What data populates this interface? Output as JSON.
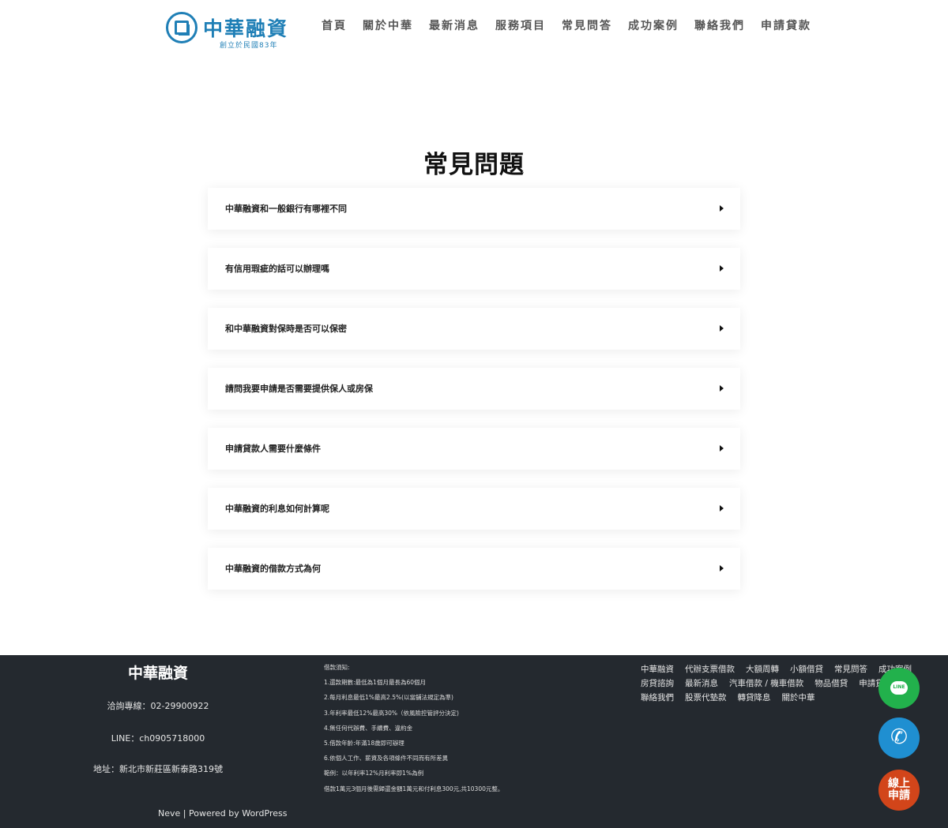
{
  "header": {
    "logo_title": "中華融資",
    "logo_subtitle": "創立於民國83年",
    "nav": [
      "首頁",
      "關於中華",
      "最新消息",
      "服務項目",
      "常見問答",
      "成功案例",
      "聯絡我們",
      "申請貸款"
    ]
  },
  "main": {
    "title": "常見問題",
    "faqs": [
      "中華融資和一般銀行有哪裡不同",
      "有信用瑕疵的話可以辦理嗎",
      "和中華融資對保時是否可以保密",
      "請問我要申請是否需要提供保人或房保",
      "申請貸款人需要什麼條件",
      "中華融資的利息如何計算呢",
      "中華融資的借款方式為何"
    ]
  },
  "footer": {
    "brand": "中華融資",
    "phone": "洽詢專線：02-29900922",
    "line": "LINE：ch0905718000",
    "address": "地址：新北市新莊區新泰路319號",
    "credit": "Neve | Powered by WordPress",
    "notes": [
      "借款須知:",
      "1.還款期數:最低為1個月最長為60個月",
      "2.每月利息最低1%最高2.5%(以當舖法規定為準)",
      "3.年利率最低12%最高30%（依風險控管評分決定)",
      "4.無任何代辦費、手續費、違約金",
      "5.借款年齡:年滿18歲即可辦理",
      "6.依個人工作、薪資及各項條件不同而有所差異",
      "範例：以年利率12%月利率即1%為例",
      "借款1萬元3個月後需歸還金額1萬元和付利息300元,共10300元整。"
    ],
    "nav_rows": [
      [
        "中華融資",
        "代辦支票借款",
        "大額周轉",
        "小額借貸",
        "常見問答",
        "成功案例"
      ],
      [
        "房貸諮詢",
        "最新消息",
        "汽車借款 / 機車借款",
        "物品借貸",
        "申請貸款"
      ],
      [
        "聯絡我們",
        "股票代墊款",
        "轉貸降息",
        "關於中華"
      ]
    ]
  },
  "floating": {
    "line_label": "LINE",
    "phone_icon": "phone-icon",
    "apply_label": [
      "線上",
      "申請"
    ]
  },
  "colors": {
    "brand_blue": "#1f7fb6",
    "footer_bg": "#24292f",
    "line_green": "#22b14c",
    "phone_blue": "#1f8fd1",
    "apply_orange": "#d2451a"
  }
}
